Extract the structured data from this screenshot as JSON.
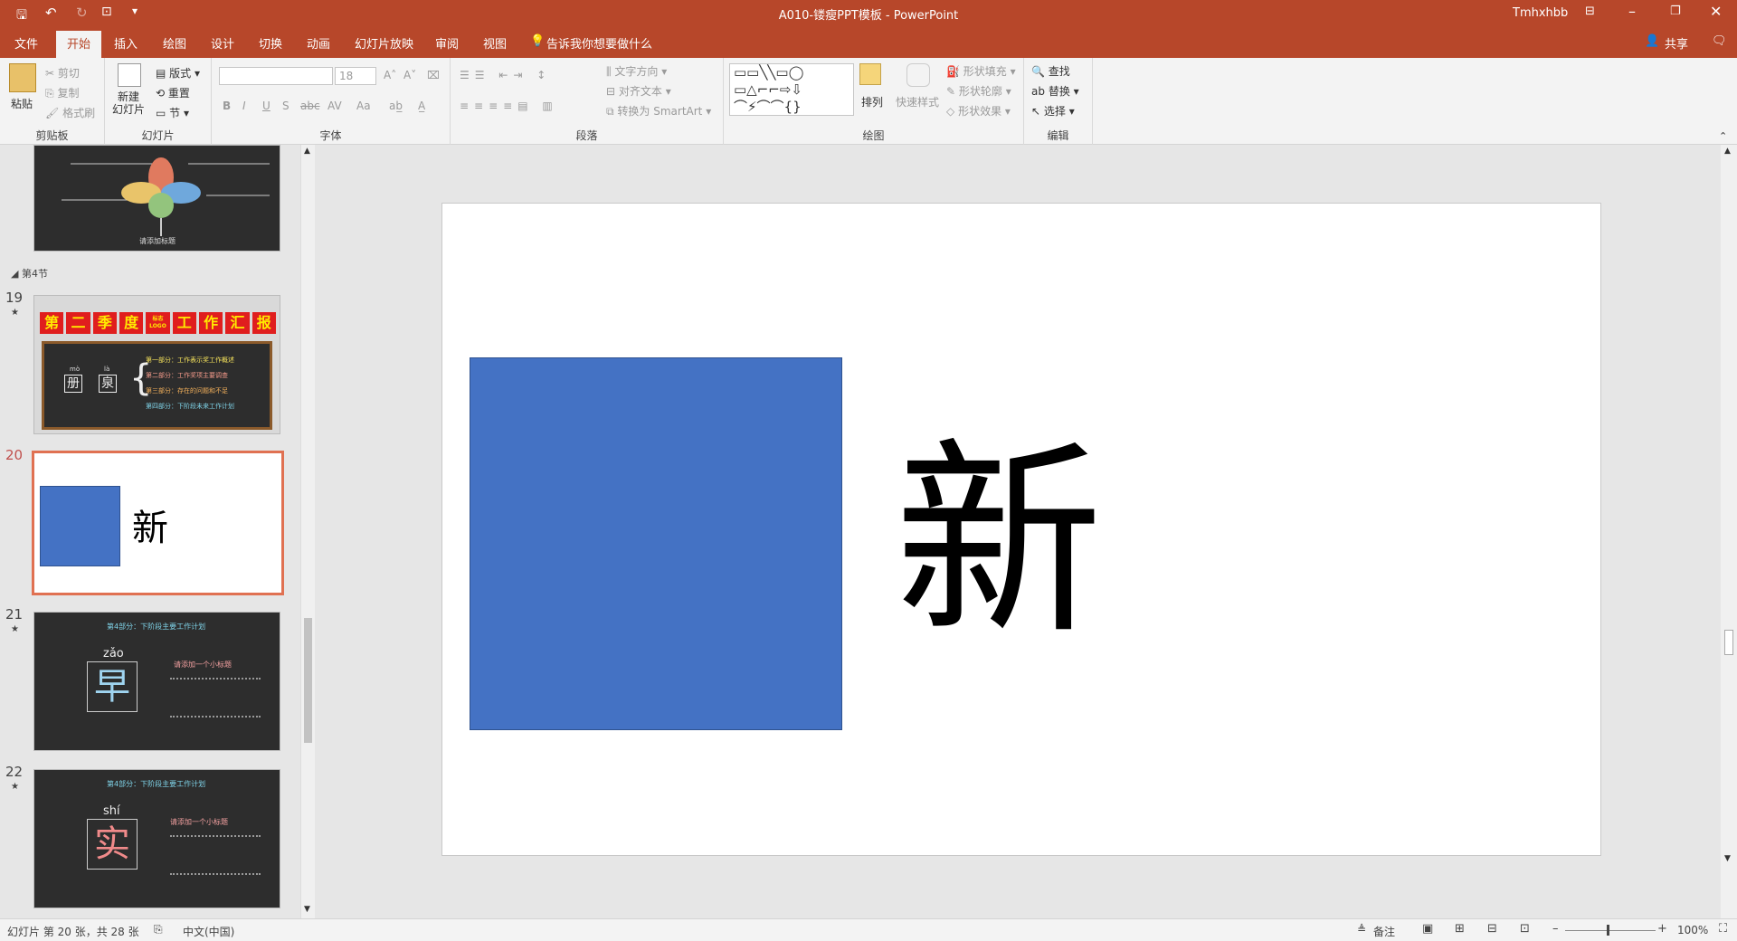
{
  "title": {
    "document": "A010-镂瘦PPT模板  -  PowerPoint",
    "user": "Tmhxhbb"
  },
  "tabs": [
    "文件",
    "开始",
    "插入",
    "绘图",
    "设计",
    "切换",
    "动画",
    "幻灯片放映",
    "审阅",
    "视图"
  ],
  "tell_me": "告诉我你想要做什么",
  "share": "共享",
  "ribbon": {
    "clipboard": {
      "paste": "粘贴",
      "cut": "剪切",
      "copy": "复制",
      "format_painter": "格式刷",
      "label": "剪贴板"
    },
    "slides": {
      "new_slide": "新建\n幻灯片",
      "layout": "版式",
      "reset": "重置",
      "section": "节",
      "label": "幻灯片"
    },
    "font": {
      "font_name": "",
      "font_size": "18",
      "label": "字体",
      "bold": "B",
      "italic": "I",
      "underline": "U",
      "shadow": "S",
      "strike": "abc",
      "spacing": "AV",
      "case": "Aa"
    },
    "paragraph": {
      "text_direction": "文字方向",
      "align_text": "对齐文本",
      "smartart": "转换为 SmartArt",
      "label": "段落"
    },
    "drawing": {
      "arrange": "排列",
      "quick_styles": "快速样式",
      "shape_fill": "形状填充",
      "shape_outline": "形状轮廓",
      "shape_effects": "形状效果",
      "label": "绘图"
    },
    "editing": {
      "find": "查找",
      "replace": "替换",
      "select": "选择",
      "label": "编辑"
    }
  },
  "slides_panel": {
    "section": "第4节",
    "slides": [
      {
        "num": "19",
        "star": "★",
        "banner": [
          "第",
          "二",
          "季",
          "度",
          "标志\nLOGO",
          "工",
          "作",
          "汇",
          "报"
        ],
        "bullets": [
          "第一部分：工作表示奖工作概述",
          "第二部分：工作奖项主要调查",
          "第三部分：存在的问题和不足",
          "第四部分：下阶段未来工作计划"
        ],
        "pinyin": [
          "mò",
          "là"
        ],
        "chars": [
          "册",
          "泉"
        ]
      },
      {
        "num": "20",
        "char": "新"
      },
      {
        "num": "21",
        "star": "★",
        "heading": "第4部分：下阶段主要工作计划",
        "pinyin": "zǎo",
        "char": "早",
        "side_title": "请添加一个小标题"
      },
      {
        "num": "22",
        "star": "★",
        "heading": "第4部分：下阶段主要工作计划",
        "pinyin": "shí",
        "char": "实",
        "side_title": "请添加一个小标题"
      }
    ],
    "top_thumb_caption": "请添加标题"
  },
  "slide": {
    "char": "新",
    "rect_color": "#4472c4"
  },
  "status": {
    "slide_info": "幻灯片 第 20 张，共 28 张",
    "language": "中文(中国)",
    "notes": "备注",
    "zoom": "100%"
  }
}
